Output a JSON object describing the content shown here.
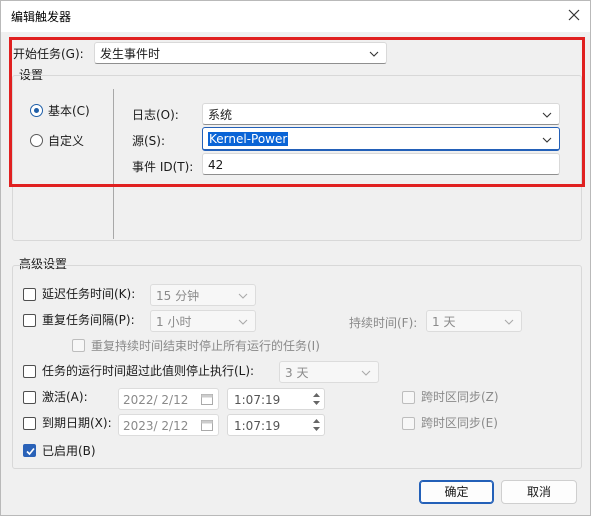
{
  "window": {
    "title": "编辑触发器"
  },
  "begin_task": {
    "label": "开始任务(G):",
    "value": "发生事件时"
  },
  "settings": {
    "group_label": "设置",
    "radio_basic": "基本(C)",
    "radio_custom": "自定义",
    "log_label": "日志(O):",
    "log_value": "系统",
    "source_label": "源(S):",
    "source_value": "Kernel-Power",
    "event_id_label": "事件 ID(T):",
    "event_id_value": "42"
  },
  "advanced": {
    "group_label": "高级设置",
    "delay_label": "延迟任务时间(K):",
    "delay_value": "15 分钟",
    "repeat_label": "重复任务间隔(P):",
    "repeat_value": "1 小时",
    "duration_label": "持续时间(F):",
    "duration_value": "1 天",
    "stop_all_label": "重复持续时间结束时停止所有运行的任务(I)",
    "stop_longer_label": "任务的运行时间超过此值则停止执行(L):",
    "stop_longer_value": "3 天",
    "activate_label": "激活(A):",
    "activate_date": "2022/  2/12",
    "activate_time": "1:07:19",
    "activate_sync": "跨时区同步(Z)",
    "expire_label": "到期日期(X):",
    "expire_date": "2023/  2/12",
    "expire_time": "1:07:19",
    "expire_sync": "跨时区同步(E)",
    "enabled_label": "已启用(B)"
  },
  "buttons": {
    "ok": "确定",
    "cancel": "取消"
  },
  "colors": {
    "accent": "#2a62b8",
    "highlight_box": "#e02020",
    "selection": "#0a64d6"
  },
  "icons": [
    "close-icon",
    "chevron-down-icon",
    "calendar-icon",
    "spin-up-icon",
    "spin-down-icon",
    "checkmark-icon"
  ]
}
